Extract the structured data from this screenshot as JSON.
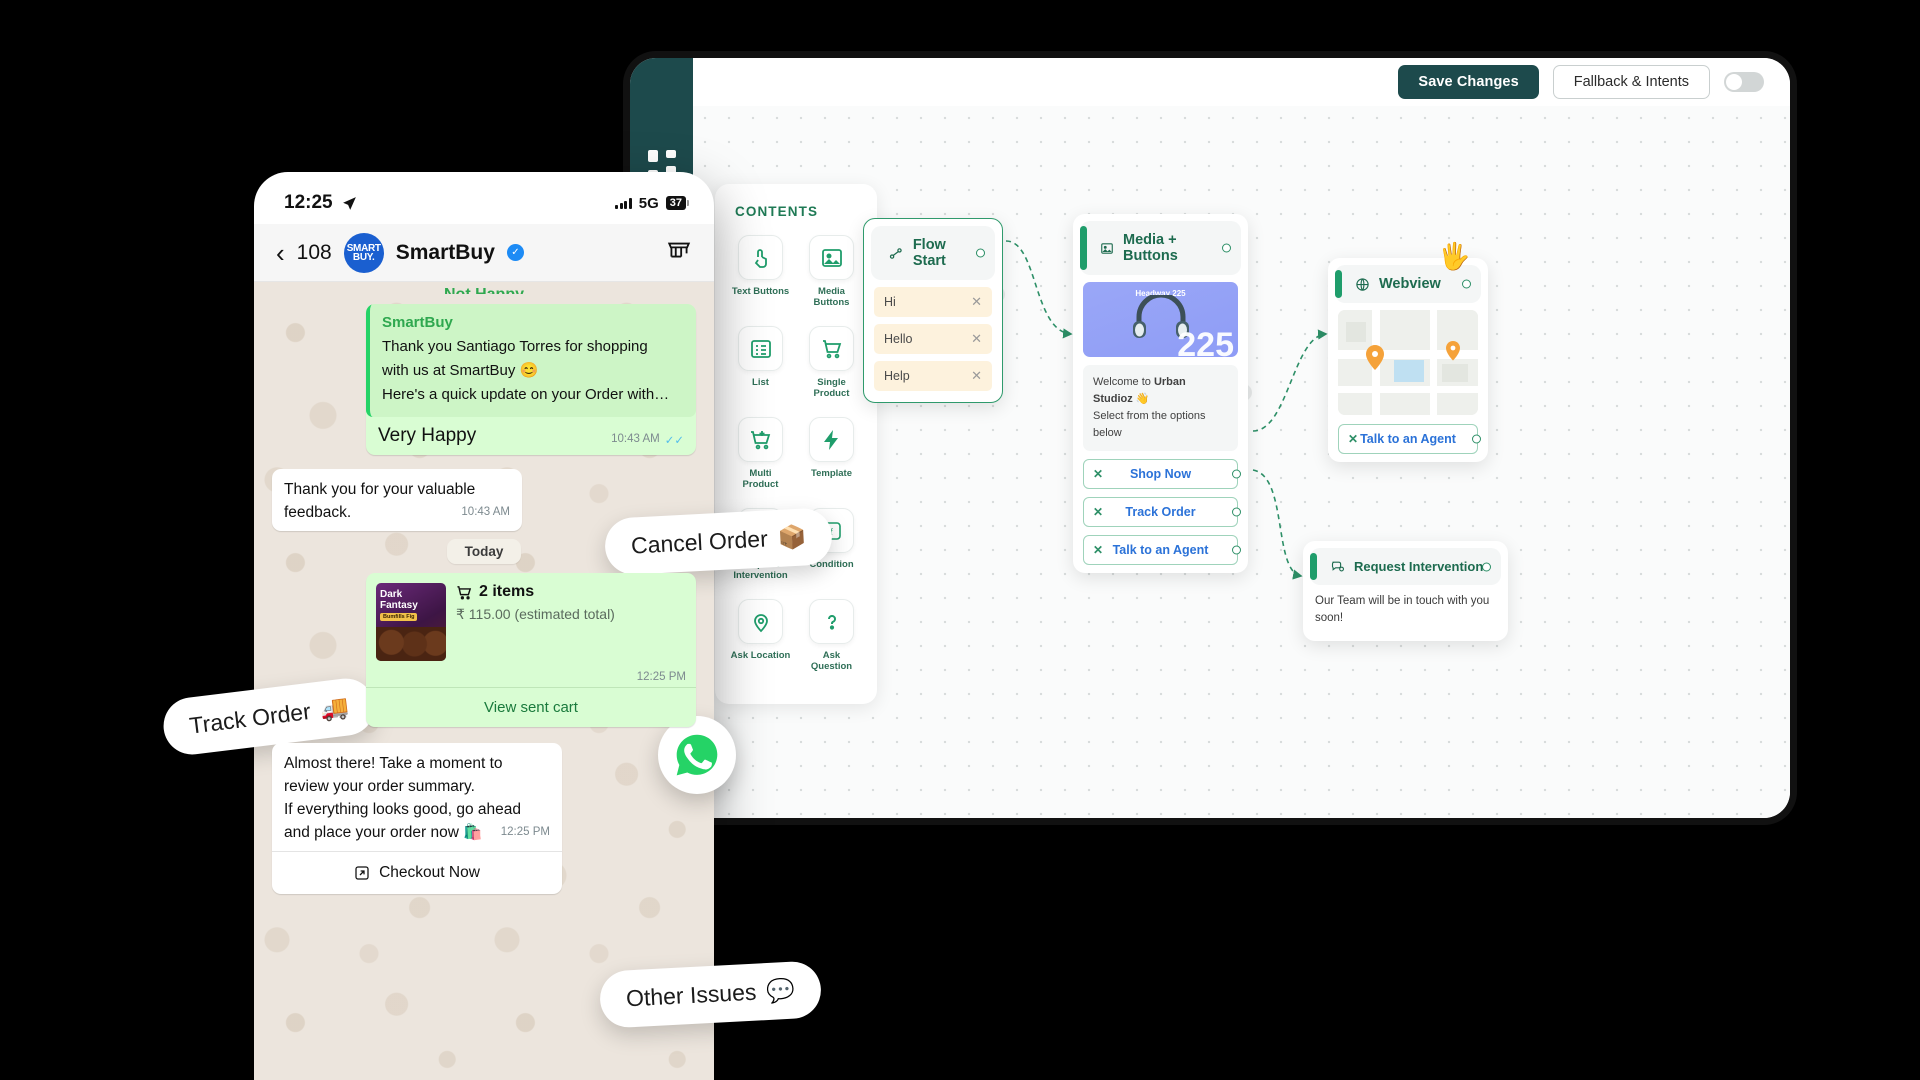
{
  "builder": {
    "topbar": {
      "save_label": "Save Changes",
      "fallback_label": "Fallback & Intents",
      "toggle_name": "publish-toggle"
    },
    "sidebar_icon": "grid-apps-icon",
    "palette": {
      "title": "CONTENTS",
      "items": [
        {
          "label": "Text Buttons",
          "icon": "tap-gesture-icon"
        },
        {
          "label": "Media Buttons",
          "icon": "image-icon"
        },
        {
          "label": "List",
          "icon": "list-icon"
        },
        {
          "label": "Single Product",
          "icon": "cart-icon"
        },
        {
          "label": "Multi Product",
          "icon": "multi-cart-icon"
        },
        {
          "label": "Template",
          "icon": "lightning-icon"
        },
        {
          "label": "Request Intervention",
          "icon": "chat-agent-icon"
        },
        {
          "label": "Condition",
          "icon": "condition-icon"
        },
        {
          "label": "Ask Location",
          "icon": "location-pin-icon"
        },
        {
          "label": "Ask Question",
          "icon": "question-mark-icon"
        }
      ]
    },
    "nodes": {
      "flow_start": {
        "title": "Flow Start",
        "icon": "flow-start-icon",
        "keywords": [
          "Hi",
          "Hello",
          "Help"
        ]
      },
      "media_buttons": {
        "title": "Media + Buttons",
        "icon": "image-icon",
        "media_caption": "Headway 225",
        "media_big_number": "225",
        "body_line1_prefix": "Welcome to ",
        "body_line1_bold": "Urban Studioz",
        "body_line1_emoji": "👋",
        "body_line2": "Select from the options below",
        "buttons": [
          "Shop Now",
          "Track Order",
          "Talk to an Agent"
        ]
      },
      "webview": {
        "title": "Webview",
        "icon": "globe-icon",
        "button": "Talk to an Agent"
      },
      "request_intervention": {
        "title": "Request Intervention",
        "icon": "chat-agent-icon",
        "body": "Our Team will be in touch with you soon!"
      }
    },
    "edge_delete_label": "✕",
    "cursor_icon": "hand-cursor-icon"
  },
  "phone": {
    "status": {
      "time": "12:25",
      "location_icon": "location-arrow-icon",
      "network": "5G",
      "battery": "37"
    },
    "header": {
      "back_icon": "chevron-left-icon",
      "unread_count": "108",
      "avatar_line1": "SMART",
      "avatar_line2": "BUY.",
      "contact": "SmartBuy",
      "verified_icon": "verified-badge-icon",
      "store_icon": "storefront-icon"
    },
    "messages": [
      {
        "type": "partial",
        "text": "Not Happy"
      },
      {
        "type": "out-brand",
        "brand": "SmartBuy",
        "line1": "Thank you Santiago Torres for shopping",
        "line2": "with us at SmartBuy 😊",
        "line3": "Here's a quick update on your Order with…"
      },
      {
        "type": "out",
        "text": "Very Happy",
        "time": "10:43 AM",
        "ticks": "✓✓"
      },
      {
        "type": "in",
        "line1": "Thank you for your valuable",
        "line2": "feedback.",
        "time": "10:43 AM"
      },
      {
        "type": "day",
        "text": "Today"
      }
    ],
    "cart": {
      "cart_icon": "shopping-cart-icon",
      "items_label": "2 items",
      "total": "₹ 115.00 (estimated total)",
      "time": "12:25 PM",
      "action": "View sent cart",
      "thumb_title_1": "Dark",
      "thumb_title_2": "Fantasy",
      "thumb_badge": "Bumfills Fig"
    },
    "final_message": {
      "line1": "Almost there! Take a moment to",
      "line2": "review your order summary.",
      "line3": "If everything looks good, go ahead",
      "line4": "and place your order now 🛍️",
      "time": "12:25 PM",
      "checkout_icon": "external-link-icon",
      "checkout_label": "Checkout Now"
    }
  },
  "pills": [
    {
      "name": "cancel-order-pill",
      "label": "Cancel Order",
      "emoji": "📦"
    },
    {
      "name": "track-order-pill",
      "label": "Track Order",
      "emoji": "🚚"
    },
    {
      "name": "other-issues-pill",
      "label": "Other Issues",
      "emoji": "💬"
    }
  ],
  "whatsapp_badge_icon": "whatsapp-icon",
  "colors": {
    "brand_dark": "#1d4a4c",
    "brand_green": "#1f9d6b",
    "wa_out_bubble": "#d9fdd3",
    "wa_chat_bg": "#ece5dd",
    "link_blue": "#2b72d8"
  }
}
